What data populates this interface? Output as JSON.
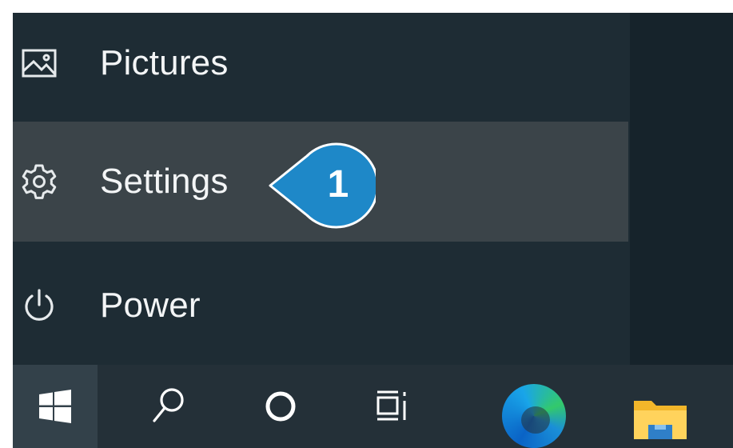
{
  "start_menu": {
    "items": [
      {
        "label": "Pictures",
        "icon": "pictures-icon"
      },
      {
        "label": "Settings",
        "icon": "gear-icon",
        "highlighted": true
      },
      {
        "label": "Power",
        "icon": "power-icon"
      }
    ]
  },
  "callout": {
    "number": "1",
    "color": "#1e88c8",
    "target": "Settings"
  },
  "taskbar": {
    "icons": [
      "windows-logo-icon",
      "search-icon",
      "cortana-icon",
      "task-view-icon",
      "edge-icon",
      "file-explorer-icon"
    ]
  },
  "colors": {
    "menu_background": "#1e2c34",
    "highlight_background": "#3b4449",
    "taskbar_background": "#243038",
    "text": "#f3f5f6"
  }
}
